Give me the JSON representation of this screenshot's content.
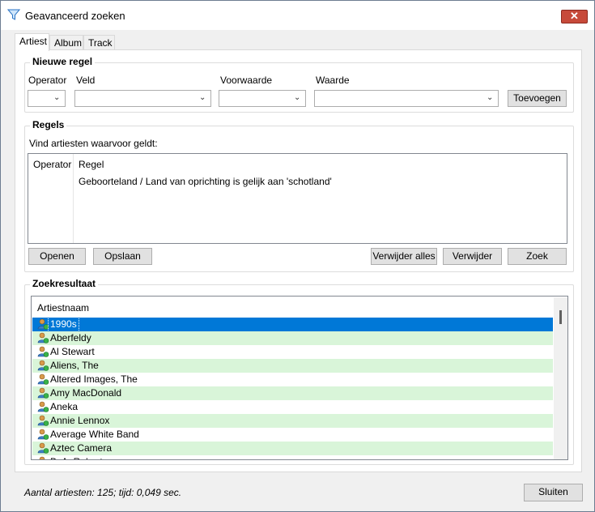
{
  "window": {
    "title": "Geavanceerd zoeken",
    "close_label": "✕"
  },
  "tabs": [
    {
      "label": "Artiest"
    },
    {
      "label": "Album"
    },
    {
      "label": "Track"
    }
  ],
  "new_rule": {
    "title": "Nieuwe regel",
    "operator_label": "Operator",
    "field_label": "Veld",
    "condition_label": "Voorwaarde",
    "value_label": "Waarde",
    "operator_value": "",
    "field_value": "",
    "condition_value": "",
    "value_value": "",
    "add_button": "Toevoegen"
  },
  "rules": {
    "title": "Regels",
    "description": "Vind artiesten waarvoor geldt:",
    "columns": {
      "operator": "Operator",
      "rule": "Regel"
    },
    "items": [
      {
        "operator": "",
        "rule": "Geboorteland / Land van oprichting is gelijk aan 'schotland'"
      }
    ],
    "open_button": "Openen",
    "save_button": "Opslaan",
    "remove_all_button": "Verwijder alles",
    "remove_button": "Verwijder",
    "search_button": "Zoek"
  },
  "results": {
    "title": "Zoekresultaat",
    "column": "Artiestnaam",
    "items": [
      "1990s",
      "Aberfeldy",
      "Al Stewart",
      "Aliens, The",
      "Altered Images, The",
      "Amy MacDonald",
      "Aneka",
      "Annie Lennox",
      "Average White Band",
      "Aztec Camera",
      "B. A. Robertson"
    ],
    "selected_index": 0
  },
  "status": "Aantal artiesten: 125; tijd: 0,049 sec.",
  "close_button": "Sluiten",
  "colors": {
    "selection": "#0078d7",
    "alt_row": "#d9f5d9"
  }
}
